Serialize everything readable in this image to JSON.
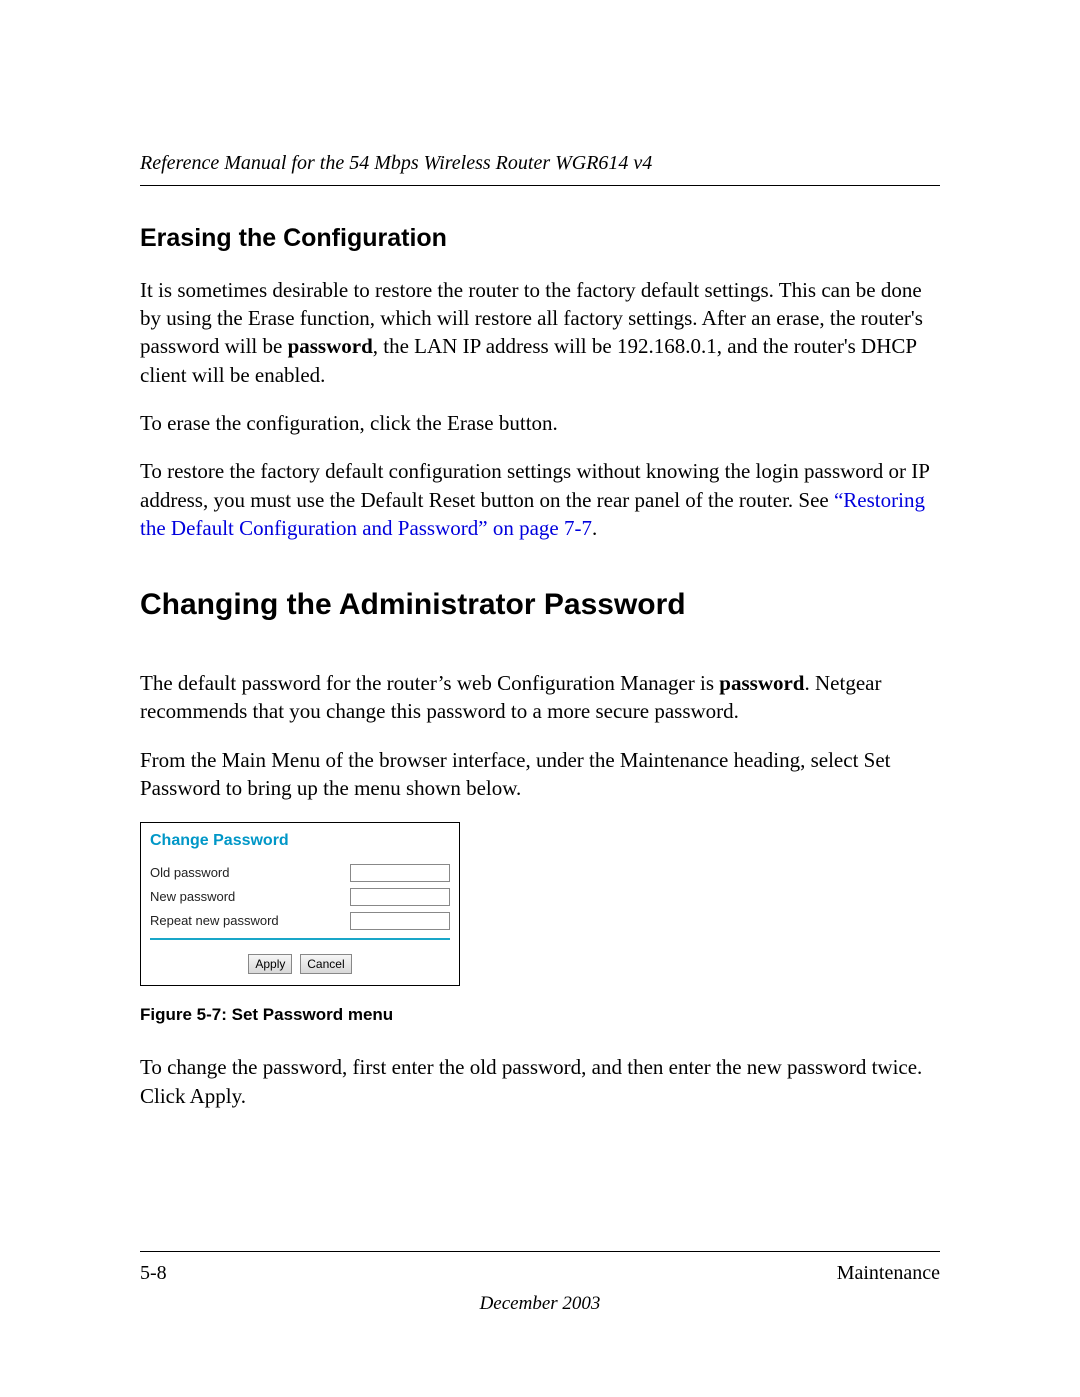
{
  "header": {
    "title": "Reference Manual for the 54 Mbps Wireless Router WGR614 v4"
  },
  "section1": {
    "heading": "Erasing the Configuration",
    "p1_a": "It is sometimes desirable to restore the router to the factory default settings. This can be done by using the Erase function, which will restore all factory settings. After an erase, the router's password will be ",
    "p1_bold": "password",
    "p1_b": ", the LAN IP address will be 192.168.0.1, and the router's DHCP client will be enabled.",
    "p2": "To erase the configuration, click the Erase button.",
    "p3_a": "To restore the factory default configuration settings without knowing the login password or IP address, you must use the Default Reset button on the rear panel of the router. See ",
    "p3_link": "“Restoring the Default Configuration and Password” on page 7-7",
    "p3_b": "."
  },
  "section2": {
    "heading": "Changing the Administrator Password",
    "p1_a": "The default password for the router’s web Configuration Manager is ",
    "p1_bold": "password",
    "p1_b": ". Netgear recommends that you change this password to a more secure password.",
    "p2": "From the Main Menu of the browser interface, under the Maintenance heading, select Set Password to bring up the menu shown below."
  },
  "figure": {
    "title": "Change Password",
    "label_old": "Old password",
    "label_new": "New password",
    "label_repeat": "Repeat new password",
    "btn_apply": "Apply",
    "btn_cancel": "Cancel",
    "caption": "Figure 5-7:  Set Password menu"
  },
  "after_figure": {
    "p1": "To change the password, first enter the old password, and then enter the new password twice. Click Apply."
  },
  "footer": {
    "page": "5-8",
    "section": "Maintenance",
    "date": "December 2003"
  }
}
